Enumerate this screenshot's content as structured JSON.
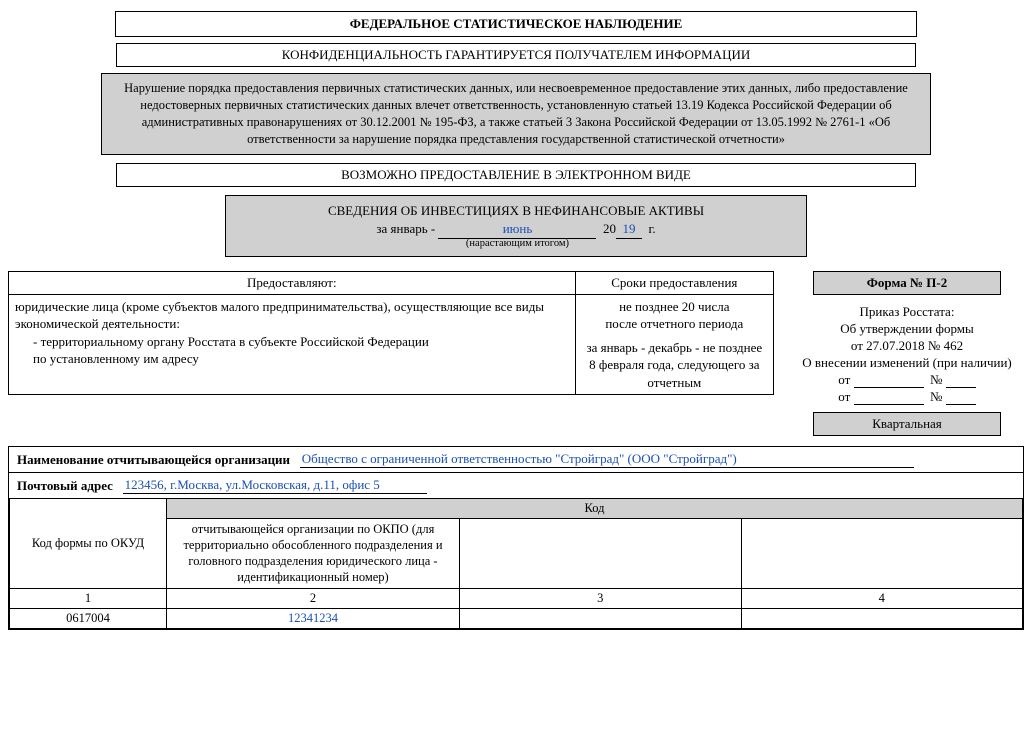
{
  "header": {
    "title": "ФЕДЕРАЛЬНОЕ СТАТИСТИЧЕСКОЕ НАБЛЮДЕНИЕ",
    "confidentiality": "КОНФИДЕНЦИАЛЬНОСТЬ ГАРАНТИРУЕТСЯ ПОЛУЧАТЕЛЕМ ИНФОРМАЦИИ",
    "warning": "Нарушение порядка предоставления первичных статистических данных, или несвоевременное предоставление этих данных, либо предоставление недостоверных первичных статистических данных влечет ответственность, установленную статьей 13.19 Кодекса Российской Федерации об административных правонарушениях от 30.12.2001 № 195-ФЗ, а также статьей 3 Закона Российской Федерации от 13.05.1992 № 2761-1 «Об ответственности за нарушение порядка представления государственной статистической отчетности»",
    "electronic": "ВОЗМОЖНО ПРЕДОСТАВЛЕНИЕ В ЭЛЕКТРОННОМ ВИДЕ",
    "subject": "СВЕДЕНИЯ ОБ ИНВЕСТИЦИЯХ В НЕФИНАНСОВЫЕ АКТИВЫ",
    "period_prefix": "за январь -",
    "period_month": "июнь",
    "period_year_prefix": "20",
    "period_year": "19",
    "period_year_suffix": "г.",
    "period_note": "(нарастающим итогом)"
  },
  "provide": {
    "header_left": "Предоставляют:",
    "header_right": "Сроки предоставления",
    "line1": "юридические лица (кроме субъектов малого предпринимательства), осуществляющие все виды экономической деятельности:",
    "line2": "- территориальному органу Росстата в субъекте Российской Федерации",
    "line3": "по установленному им адресу",
    "deadline1": "не позднее 20 числа",
    "deadline2": "после отчетного периода",
    "deadline3": "за январь - декабрь - не позднее 8 февраля года, следующего за отчетным"
  },
  "form": {
    "form_no": "Форма № П-2",
    "order1": "Приказ Росстата:",
    "order2": "Об утверждении формы",
    "order3": "от 27.07.2018 № 462",
    "order4": "О внесении изменений (при наличии)",
    "ot": "от",
    "no": "№",
    "periodicity": "Квартальная"
  },
  "org": {
    "name_label": "Наименование отчитывающейся организации",
    "name_value": "Общество с ограниченной ответственностью \"Стройград\" (ООО \"Стройград\")",
    "address_label": "Почтовый адрес",
    "address_value": "123456, г.Москва, ул.Московская, д.11, офис 5"
  },
  "codes": {
    "code_header": "Код",
    "col1_header": "Код формы по ОКУД",
    "col2_header": "отчитывающейся организации по ОКПО (для территориально обособленного подразделения и головного подразделения юридического лица - идентификационный номер)",
    "row_nums": [
      "1",
      "2",
      "3",
      "4"
    ],
    "okud": "0617004",
    "okpo": "12341234"
  }
}
